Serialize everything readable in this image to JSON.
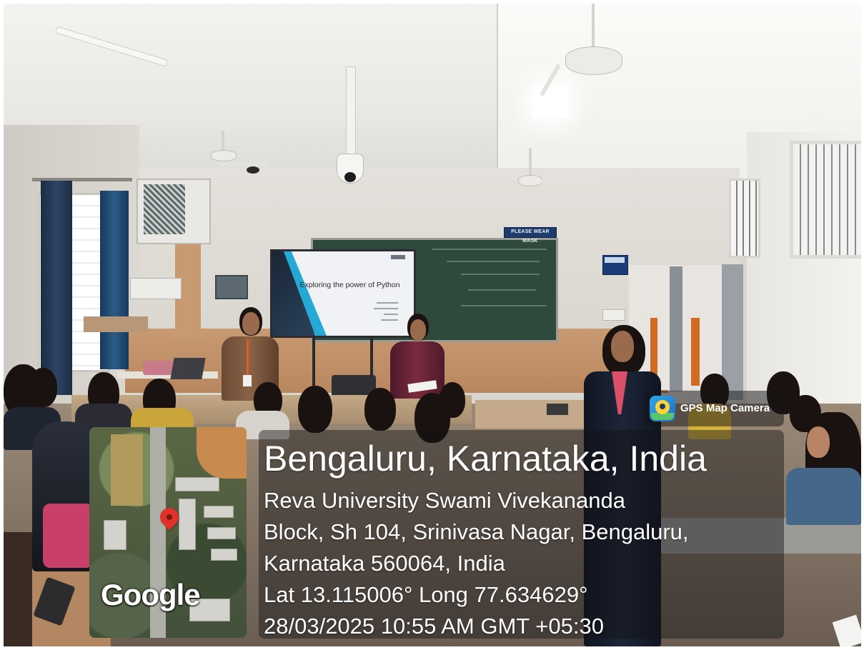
{
  "overlay": {
    "app_name": "GPS Map Camera",
    "app_icon": "gps-map-camera-icon",
    "map_brand": "Google",
    "map_pin": "location-pin-icon",
    "location_title": "Bengaluru, Karnataka, India",
    "address_lines": [
      "Reva University Swami Vivekananda",
      "Block, Sh 104, Srinivasa Nagar, Bengaluru,",
      "Karnataka 560064, India"
    ],
    "coordinates": "Lat 13.115006° Long 77.634629°",
    "datetime": "28/03/2025 10:55 AM GMT +05:30"
  },
  "scene": {
    "slide_title": "Exploring the power of Python",
    "wall_sign": "PLEASE WEAR MASK"
  },
  "colors": {
    "pin_red": "#e0322b",
    "panel_overlay": "rgba(20,20,22,0.45)",
    "chalkboard_green": "#2f4a3c",
    "slide_accent": "#27a9d6"
  }
}
